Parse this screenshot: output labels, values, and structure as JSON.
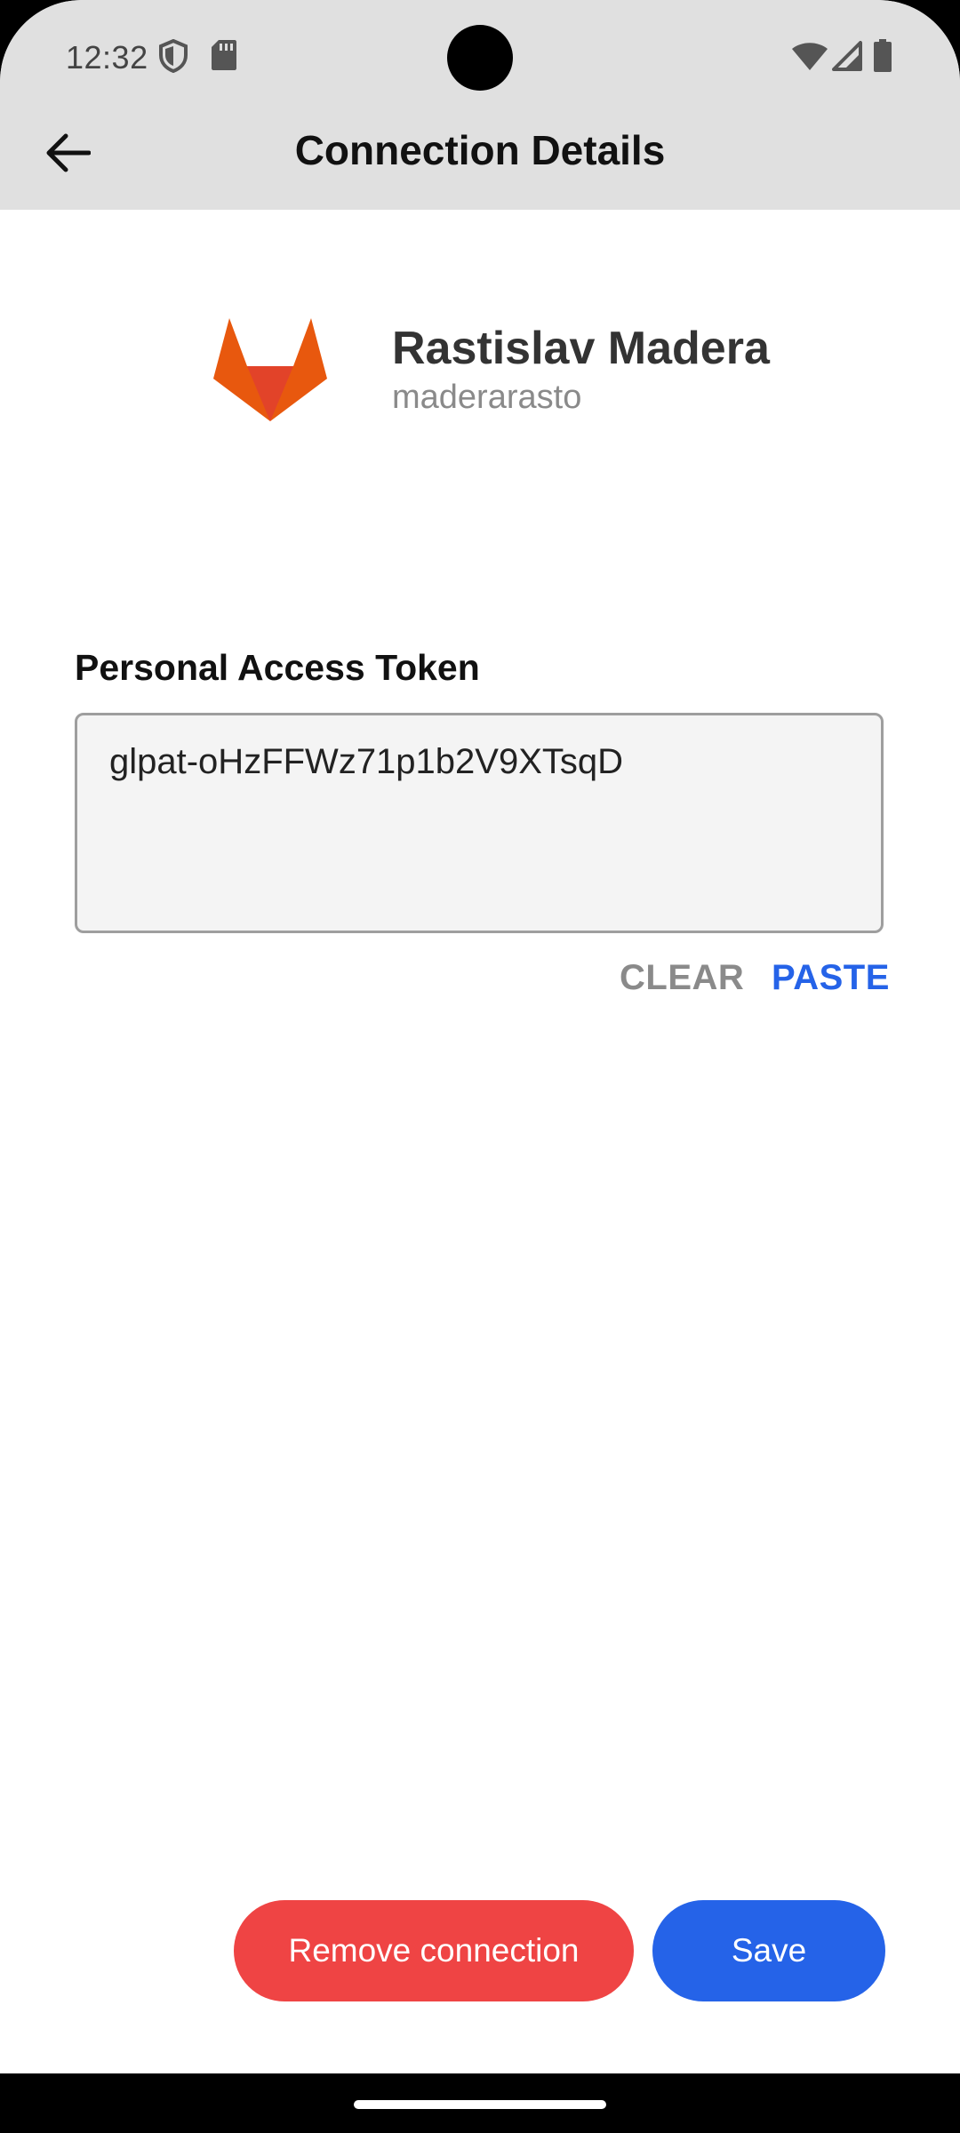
{
  "status_bar": {
    "time": "12:32",
    "icons": [
      "shield-icon",
      "sd-card-icon",
      "wifi-icon",
      "signal-icon",
      "battery-icon"
    ]
  },
  "app_bar": {
    "title": "Connection Details",
    "back_icon": "arrow-left-icon"
  },
  "account": {
    "logo_icon": "gitlab-logo",
    "name": "Rastislav Madera",
    "username": "maderarasto"
  },
  "token": {
    "label": "Personal Access Token",
    "value": "glpat-oHzFFWz71p1b2V9XTsqD"
  },
  "actions": {
    "clear_label": "CLEAR",
    "paste_label": "PASTE",
    "remove_label": "Remove connection",
    "save_label": "Save"
  },
  "colors": {
    "header_bg": "#e0e0e0",
    "primary": "#2563e8",
    "danger": "#ef4444",
    "gitlab_orange": "#e8580e",
    "muted_text": "#8a8a8a"
  }
}
